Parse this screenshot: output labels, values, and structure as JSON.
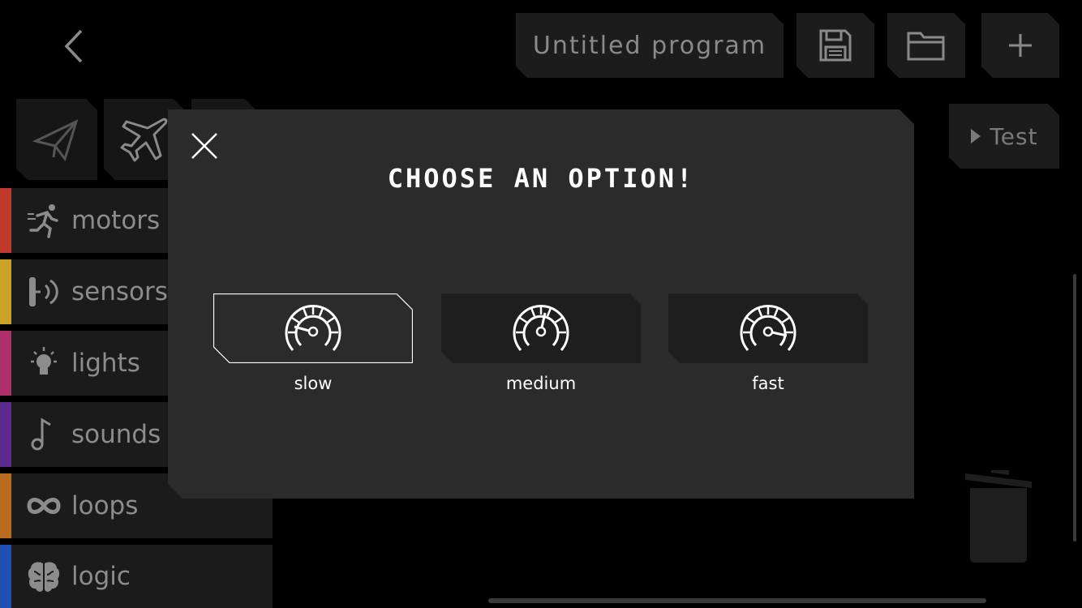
{
  "header": {
    "back_icon": "chevron-left-icon",
    "program_title": "Untitled program",
    "save_icon": "save-icon",
    "open_icon": "folder-icon",
    "new_icon": "plus-icon"
  },
  "test_button": {
    "label": "Test",
    "icon": "play-icon"
  },
  "drone_tiles": [
    {
      "icon": "paper-plane-icon"
    },
    {
      "icon": "airplane-icon"
    }
  ],
  "sidebar": {
    "items": [
      {
        "label": "motors",
        "icon": "running-man-icon",
        "color": "#c0392b"
      },
      {
        "label": "sensors",
        "icon": "sensor-icon",
        "color": "#c9a227"
      },
      {
        "label": "lights",
        "icon": "lightbulb-icon",
        "color": "#b0306e"
      },
      {
        "label": "sounds",
        "icon": "music-note-icon",
        "color": "#5b2a8c"
      },
      {
        "label": "loops",
        "icon": "infinity-icon",
        "color": "#b86a1e"
      },
      {
        "label": "logic",
        "icon": "brain-icon",
        "color": "#1f4fb5"
      }
    ]
  },
  "modal": {
    "title": "CHOOSE AN OPTION!",
    "close_icon": "close-icon",
    "options": [
      {
        "label": "slow",
        "icon": "speedometer-slow-icon",
        "selected": true
      },
      {
        "label": "medium",
        "icon": "speedometer-medium-icon",
        "selected": false
      },
      {
        "label": "fast",
        "icon": "speedometer-fast-icon",
        "selected": false
      }
    ]
  },
  "trash_icon": "trash-icon"
}
